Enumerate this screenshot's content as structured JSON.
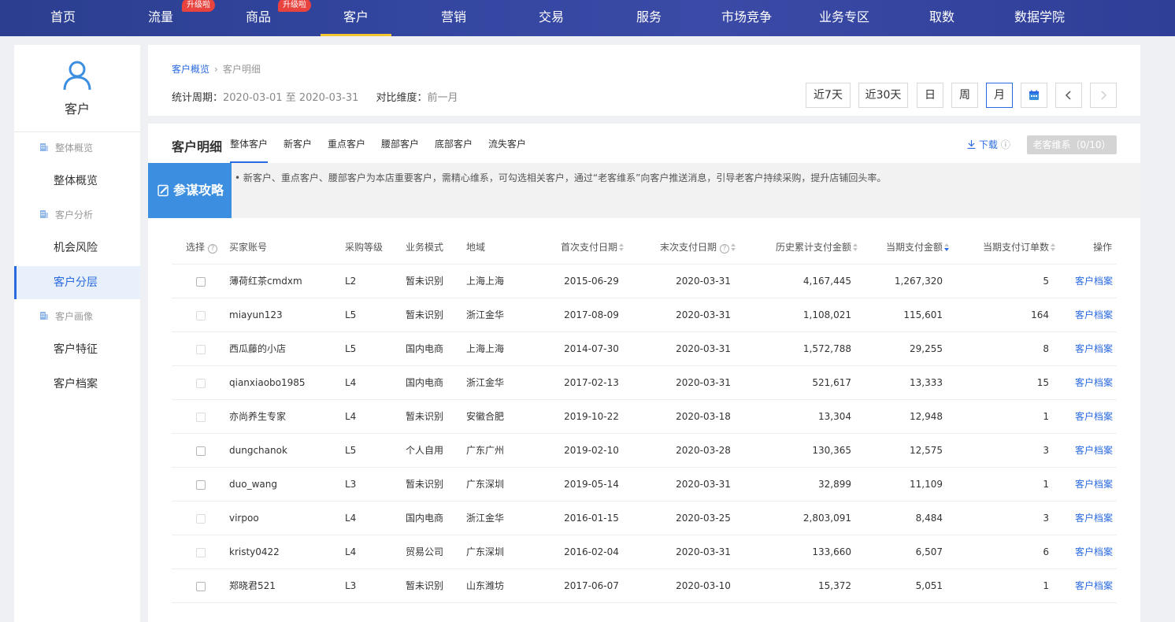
{
  "topnav": {
    "items": [
      {
        "label": "首页"
      },
      {
        "label": "流量",
        "badge": "升级啦"
      },
      {
        "label": "商品",
        "badge": "升级啦"
      },
      {
        "label": "客户",
        "active": true
      },
      {
        "label": "营销"
      },
      {
        "label": "交易"
      },
      {
        "label": "服务"
      },
      {
        "label": "市场竞争"
      },
      {
        "label": "业务专区"
      },
      {
        "label": "取数"
      },
      {
        "label": "数据学院"
      }
    ],
    "accent": "#f3c531"
  },
  "sidebar": {
    "title": "客户",
    "groups": [
      {
        "label": "整体概览",
        "links": [
          "整体概览"
        ]
      },
      {
        "label": "客户分析",
        "links": [
          "机会风险",
          "客户分层"
        ]
      },
      {
        "label": "客户画像",
        "links": [
          "客户特征",
          "客户档案"
        ]
      }
    ],
    "active": "客户分层"
  },
  "header": {
    "breadcrumb": [
      "客户概览",
      "客户明细"
    ],
    "period_label": "统计周期：",
    "period_value": "2020-03-01 至 2020-03-31",
    "compare_label": "对比维度：",
    "compare_value": "前一月",
    "time_buttons": [
      "近7天",
      "近30天",
      "日",
      "周",
      "月"
    ],
    "active_time": "月"
  },
  "main": {
    "section_title": "客户明细",
    "tabs": [
      "整体客户",
      "新客户",
      "重点客户",
      "腰部客户",
      "底部客户",
      "流失客户"
    ],
    "active_tab": "整体客户",
    "download_label": "下载",
    "old_customer_button": "老客维系（0/10）",
    "tip_badge": "参谋攻略",
    "tip_text": "• 新客户、重点客户、腰部客户为本店重要客户，需精心维系，可勾选相关客户，通过“老客维系”向客户推送消息，引导老客户持续采购，提升店铺回头率。"
  },
  "table": {
    "headers": {
      "select": "选择",
      "account": "买家账号",
      "level": "采购等级",
      "mode": "业务模式",
      "region": "地域",
      "first_pay": "首次支付日期",
      "last_pay": "末次支付日期",
      "total_amount": "历史累计支付金额",
      "period_amount": "当期支付金额",
      "period_orders": "当期支付订单数",
      "action": "操作"
    },
    "action_label": "客户档案",
    "rows": [
      {
        "account": "薄荷红茶cmdxm",
        "level": "L2",
        "mode": "暂未识别",
        "region": "上海上海",
        "first": "2015-06-29",
        "last": "2020-03-31",
        "total": "4,167,445",
        "amount": "1,267,320",
        "orders": "5",
        "selectable": true
      },
      {
        "account": "miayun123",
        "level": "L5",
        "mode": "暂未识别",
        "region": "浙江金华",
        "first": "2017-08-09",
        "last": "2020-03-31",
        "total": "1,108,021",
        "amount": "115,601",
        "orders": "164",
        "selectable": false
      },
      {
        "account": "西瓜藤的小店",
        "level": "L5",
        "mode": "国内电商",
        "region": "上海上海",
        "first": "2014-07-30",
        "last": "2020-03-31",
        "total": "1,572,788",
        "amount": "29,255",
        "orders": "8",
        "selectable": false
      },
      {
        "account": "qianxiaobo1985",
        "level": "L4",
        "mode": "国内电商",
        "region": "浙江金华",
        "first": "2017-02-13",
        "last": "2020-03-31",
        "total": "521,617",
        "amount": "13,333",
        "orders": "15",
        "selectable": false
      },
      {
        "account": "亦尚养生专家",
        "level": "L4",
        "mode": "暂未识别",
        "region": "安徽合肥",
        "first": "2019-10-22",
        "last": "2020-03-18",
        "total": "13,304",
        "amount": "12,948",
        "orders": "1",
        "selectable": false
      },
      {
        "account": "dungchanok",
        "level": "L5",
        "mode": "个人自用",
        "region": "广东广州",
        "first": "2019-02-10",
        "last": "2020-03-28",
        "total": "130,365",
        "amount": "12,575",
        "orders": "3",
        "selectable": true
      },
      {
        "account": "duo_wang",
        "level": "L3",
        "mode": "暂未识别",
        "region": "广东深圳",
        "first": "2019-05-14",
        "last": "2020-03-31",
        "total": "32,899",
        "amount": "11,109",
        "orders": "1",
        "selectable": true
      },
      {
        "account": "virpoo",
        "level": "L4",
        "mode": "国内电商",
        "region": "浙江金华",
        "first": "2016-01-15",
        "last": "2020-03-25",
        "total": "2,803,091",
        "amount": "8,484",
        "orders": "3",
        "selectable": false
      },
      {
        "account": "kristy0422",
        "level": "L4",
        "mode": "贸易公司",
        "region": "广东深圳",
        "first": "2016-02-04",
        "last": "2020-03-31",
        "total": "133,660",
        "amount": "6,507",
        "orders": "6",
        "selectable": false
      },
      {
        "account": "郑晓君521",
        "level": "L3",
        "mode": "暂未识别",
        "region": "山东潍坊",
        "first": "2017-06-07",
        "last": "2020-03-10",
        "total": "15,372",
        "amount": "5,051",
        "orders": "1",
        "selectable": true
      }
    ]
  }
}
